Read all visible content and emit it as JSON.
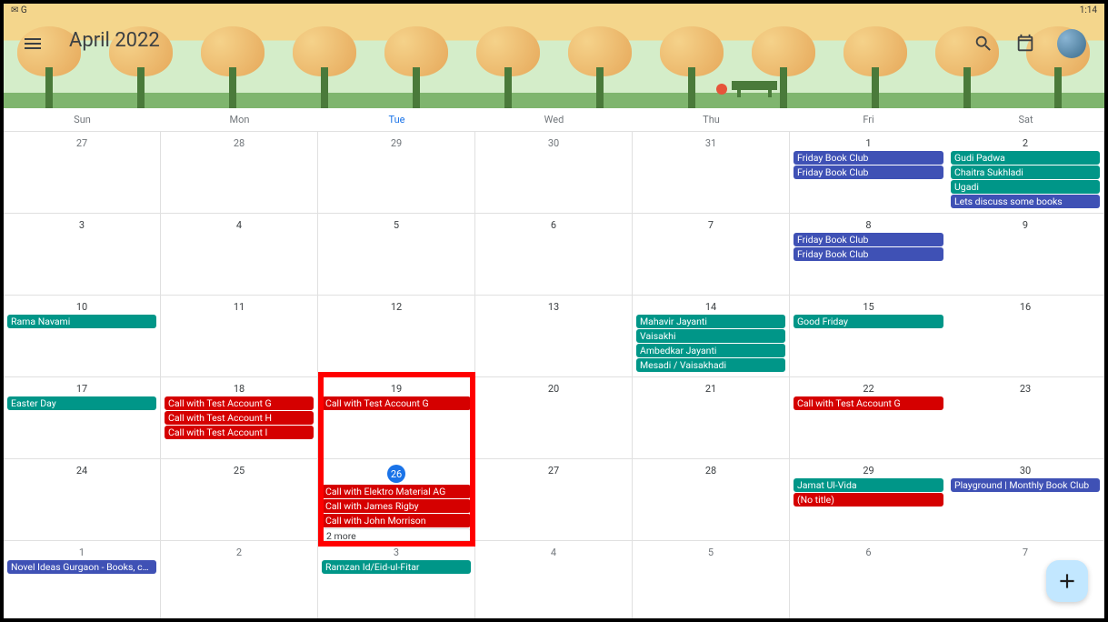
{
  "status": {
    "time": "1:14",
    "icons": "✉ G"
  },
  "header": {
    "title": "April 2022"
  },
  "dow": [
    "Sun",
    "Mon",
    "Tue",
    "Wed",
    "Thu",
    "Fri",
    "Sat"
  ],
  "weeks": [
    [
      {
        "num": "27",
        "out": true,
        "events": []
      },
      {
        "num": "28",
        "out": true,
        "events": []
      },
      {
        "num": "29",
        "out": true,
        "events": []
      },
      {
        "num": "30",
        "out": true,
        "events": []
      },
      {
        "num": "31",
        "out": true,
        "events": []
      },
      {
        "num": "1",
        "events": [
          {
            "t": "Friday Book Club",
            "c": "indigo"
          },
          {
            "t": "Friday Book Club",
            "c": "indigo"
          }
        ]
      },
      {
        "num": "2",
        "events": [
          {
            "t": "Gudi Padwa",
            "c": "teal"
          },
          {
            "t": "Chaitra Sukhladi",
            "c": "teal"
          },
          {
            "t": "Ugadi",
            "c": "teal"
          },
          {
            "t": "Lets discuss some books",
            "c": "indigo"
          }
        ]
      }
    ],
    [
      {
        "num": "3",
        "events": []
      },
      {
        "num": "4",
        "events": []
      },
      {
        "num": "5",
        "events": []
      },
      {
        "num": "6",
        "events": []
      },
      {
        "num": "7",
        "events": []
      },
      {
        "num": "8",
        "events": [
          {
            "t": "Friday Book Club",
            "c": "indigo"
          },
          {
            "t": "Friday Book Club",
            "c": "indigo"
          }
        ]
      },
      {
        "num": "9",
        "events": []
      }
    ],
    [
      {
        "num": "10",
        "events": [
          {
            "t": "Rama Navami",
            "c": "teal"
          }
        ]
      },
      {
        "num": "11",
        "events": []
      },
      {
        "num": "12",
        "events": []
      },
      {
        "num": "13",
        "events": []
      },
      {
        "num": "14",
        "events": [
          {
            "t": "Mahavir Jayanti",
            "c": "teal"
          },
          {
            "t": "Vaisakhi",
            "c": "teal"
          },
          {
            "t": "Ambedkar Jayanti",
            "c": "teal"
          },
          {
            "t": "Mesadi / Vaisakhadi",
            "c": "teal"
          }
        ]
      },
      {
        "num": "15",
        "events": [
          {
            "t": "Good Friday",
            "c": "teal"
          }
        ]
      },
      {
        "num": "16",
        "events": []
      }
    ],
    [
      {
        "num": "17",
        "events": [
          {
            "t": "Easter Day",
            "c": "teal"
          }
        ]
      },
      {
        "num": "18",
        "events": [
          {
            "t": "Call with Test Account G",
            "c": "red"
          },
          {
            "t": "Call with Test Account H",
            "c": "red"
          },
          {
            "t": "Call with Test Account I",
            "c": "red"
          }
        ]
      },
      {
        "num": "19",
        "events": [
          {
            "t": "Call with Test Account G",
            "c": "red"
          }
        ]
      },
      {
        "num": "20",
        "events": []
      },
      {
        "num": "21",
        "events": []
      },
      {
        "num": "22",
        "events": [
          {
            "t": "Call with Test Account G",
            "c": "red"
          }
        ]
      },
      {
        "num": "23",
        "events": []
      }
    ],
    [
      {
        "num": "24",
        "events": []
      },
      {
        "num": "25",
        "events": []
      },
      {
        "num": "26",
        "today": true,
        "events": [
          {
            "t": "Call with Elektro Material AG",
            "c": "red"
          },
          {
            "t": "Call with James Rigby",
            "c": "red"
          },
          {
            "t": "Call with John Morrison",
            "c": "red"
          },
          {
            "t": "2 more",
            "c": "white"
          }
        ]
      },
      {
        "num": "27",
        "events": []
      },
      {
        "num": "28",
        "events": []
      },
      {
        "num": "29",
        "events": [
          {
            "t": "Jamat Ul-Vida",
            "c": "teal"
          },
          {
            "t": "(No title)",
            "c": "red"
          }
        ]
      },
      {
        "num": "30",
        "events": [
          {
            "t": "Playground | Monthly Book Club",
            "c": "indigo"
          }
        ]
      }
    ],
    [
      {
        "num": "1",
        "out": true,
        "events": [
          {
            "t": "Novel Ideas Gurgaon - Books, coffee an",
            "c": "indigo"
          }
        ]
      },
      {
        "num": "2",
        "out": true,
        "events": []
      },
      {
        "num": "3",
        "out": true,
        "events": [
          {
            "t": "Ramzan Id/Eid-ul-Fitar",
            "c": "teal"
          }
        ]
      },
      {
        "num": "4",
        "out": true,
        "events": []
      },
      {
        "num": "5",
        "out": true,
        "events": []
      },
      {
        "num": "6",
        "out": true,
        "events": []
      },
      {
        "num": "7",
        "out": true,
        "events": []
      }
    ]
  ],
  "highlight": {
    "col": 2,
    "rowStart": 3,
    "rowSpan": 2
  }
}
